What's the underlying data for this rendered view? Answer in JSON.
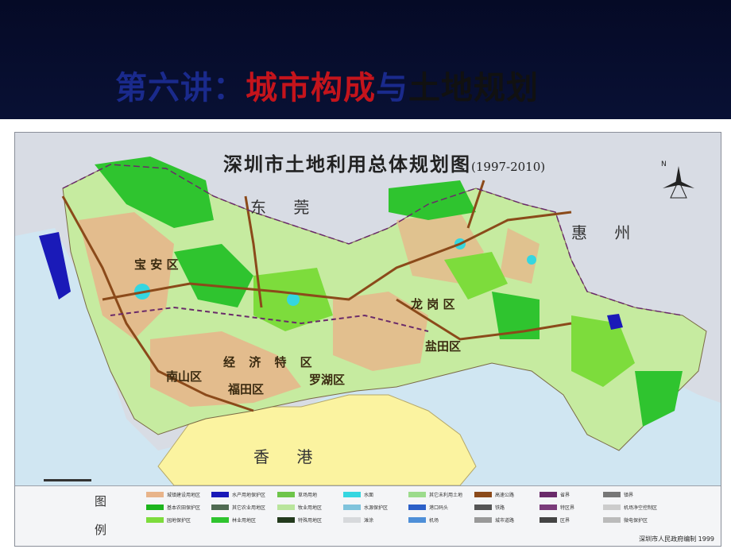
{
  "slide": {
    "title_part1": "第六讲：",
    "title_part2": "城市构成",
    "title_part3": "与",
    "title_part4": "土地规划"
  },
  "map": {
    "title": "深圳市土地利用总体规划图",
    "years": "(1997-2010)",
    "places": {
      "dongguan": "东 莞",
      "huizhou": "惠 州",
      "hongkong": "香 港"
    },
    "districts": {
      "baoan": "宝 安 区",
      "longgang": "龙 岗 区",
      "yantian": "盐田区",
      "nanshan": "南山区",
      "futian": "福田区",
      "luohu": "罗湖区",
      "special_zone": "经 济 特 区"
    },
    "legend_label_top": "图",
    "legend_label_bottom": "例",
    "legend": [
      {
        "label": "城镇建设用地区",
        "color": "#e8b48a"
      },
      {
        "label": "基本农田保护区",
        "color": "#1db51d"
      },
      {
        "label": "园地保护区",
        "color": "#7ddc3c"
      },
      {
        "label": "水产用地保护区",
        "color": "#1a1ab8"
      },
      {
        "label": "其它农业用地区",
        "color": "#4f6a52"
      },
      {
        "label": "林业用地区",
        "color": "#2fc42f"
      },
      {
        "label": "草场用地",
        "color": "#6ec54a"
      },
      {
        "label": "牧业用地区",
        "color": "#b9e59c"
      },
      {
        "label": "特殊用地区",
        "color": "#233a1d"
      },
      {
        "label": "水面",
        "color": "#35d6e0"
      },
      {
        "label": "水源保护区",
        "color": "#7fc3dc"
      },
      {
        "label": "滩涂",
        "color": "#d7d9dc"
      },
      {
        "label": "其它未利用土地",
        "color": "#9cdb8c"
      },
      {
        "label": "港口码头",
        "color": "#2c60c8"
      },
      {
        "label": "机场",
        "color": "#4e8fd8"
      },
      {
        "label": "高速公路",
        "color": "#8b4a1a"
      },
      {
        "label": "铁路",
        "color": "#555555"
      },
      {
        "label": "城市道路",
        "color": "#999999"
      },
      {
        "label": "省界",
        "color": "#6a2a6a"
      },
      {
        "label": "特区界",
        "color": "#7a3b7a"
      },
      {
        "label": "区界",
        "color": "#444444"
      },
      {
        "label": "镇界",
        "color": "#777777"
      },
      {
        "label": "机场净空控制区",
        "color": "#cccccc"
      },
      {
        "label": "微电保护区",
        "color": "#bbbbbb"
      }
    ],
    "credit": "深圳市人民政府编制  1999"
  }
}
